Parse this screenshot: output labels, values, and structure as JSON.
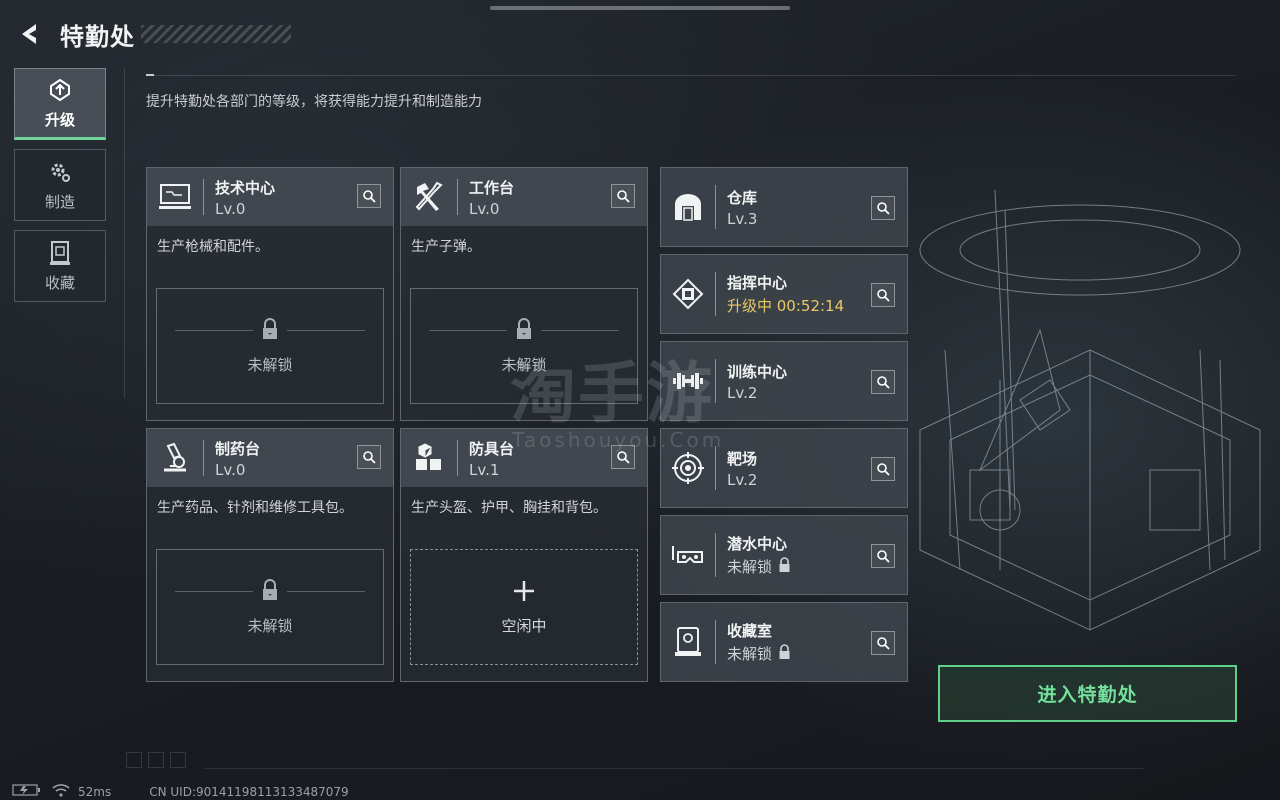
{
  "header": {
    "title": "特勤处",
    "back_icon": "back-arrow-icon"
  },
  "nav": {
    "items": [
      {
        "label": "升级",
        "icon": "upgrade-icon",
        "active": true
      },
      {
        "label": "制造",
        "icon": "gear-icon",
        "active": false
      },
      {
        "label": "收藏",
        "icon": "collection-icon",
        "active": false
      }
    ]
  },
  "subtitle": "提升特勤处各部门的等级，将获得能力提升和制造能力",
  "big_cards": [
    {
      "name": "技术中心",
      "level": "Lv.0",
      "desc": "生产枪械和配件。",
      "status": "未解锁",
      "icon": "computer-icon"
    },
    {
      "name": "工作台",
      "level": "Lv.0",
      "desc": "生产子弹。",
      "status": "未解锁",
      "icon": "tools-icon"
    },
    {
      "name": "制药台",
      "level": "Lv.0",
      "desc": "生产药品、针剂和维修工具包。",
      "status": "未解锁",
      "icon": "microscope-icon"
    },
    {
      "name": "防具台",
      "level": "Lv.1",
      "desc": "生产头盔、护甲、胸挂和背包。",
      "status": "空闲中",
      "icon": "cubes-icon"
    }
  ],
  "small_cards": [
    {
      "name": "仓库",
      "level": "Lv.3",
      "icon": "warehouse-icon"
    },
    {
      "name": "指挥中心",
      "level": "升级中 00:52:14",
      "icon": "chip-icon"
    },
    {
      "name": "训练中心",
      "level": "Lv.2",
      "icon": "dumbbell-icon"
    },
    {
      "name": "靶场",
      "level": "Lv.2",
      "icon": "target-icon"
    },
    {
      "name": "潜水中心",
      "level": "未解锁",
      "icon": "diving-mask-icon"
    },
    {
      "name": "收藏室",
      "level": "未解锁",
      "icon": "display-case-icon"
    }
  ],
  "enter_button": "进入特勤处",
  "watermark": {
    "cn": "淘手游",
    "en": "Taoshouyou.Com"
  },
  "footer": {
    "ping": "52ms",
    "uid": "CN UID:901411981131334870​79"
  },
  "colors": {
    "accent_green": "#6fd59a",
    "upgrading_yellow": "#e9c866"
  }
}
